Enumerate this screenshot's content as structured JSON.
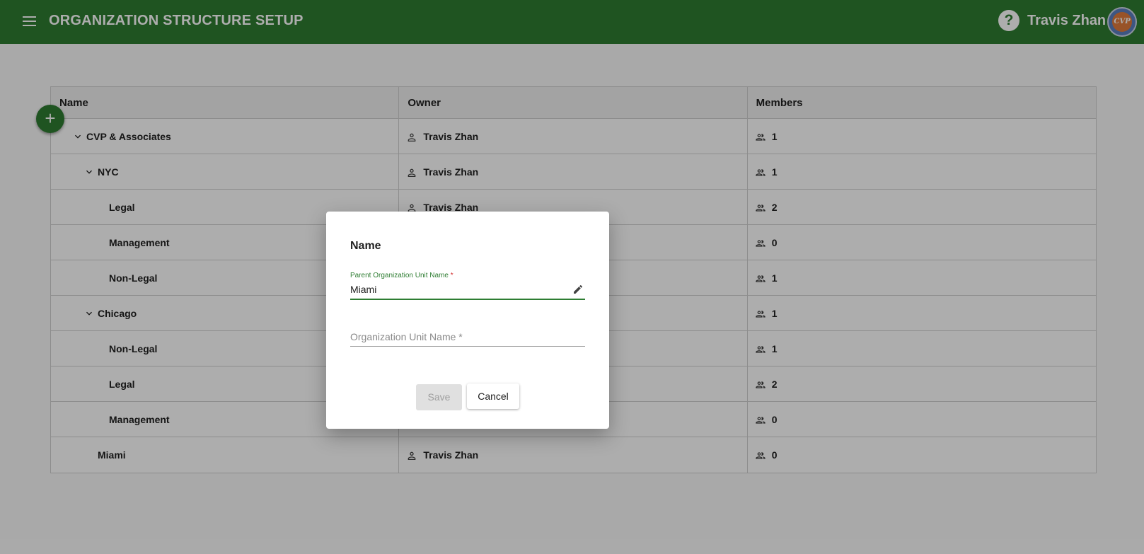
{
  "header": {
    "title": "ORGANIZATION STRUCTURE SETUP",
    "user_name": "Travis Zhan",
    "avatar_text": "CVP",
    "help_icon": "help-circle-icon",
    "menu_icon": "hamburger-menu-icon"
  },
  "table": {
    "columns": [
      "Name",
      "Owner",
      "Members"
    ],
    "rows": [
      {
        "name": "CVP & Associates",
        "owner": "Travis Zhan",
        "members": "1"
      },
      {
        "name": "NYC",
        "owner": "Travis Zhan",
        "members": "1"
      },
      {
        "name": "Legal",
        "owner": "Travis Zhan",
        "members": "2"
      },
      {
        "name": "Management",
        "owner": "",
        "members": "0"
      },
      {
        "name": "Non-Legal",
        "owner": "",
        "members": "1"
      },
      {
        "name": "Chicago",
        "owner": "",
        "members": "1"
      },
      {
        "name": "Non-Legal",
        "owner": "",
        "members": "1"
      },
      {
        "name": "Legal",
        "owner": "",
        "members": "2"
      },
      {
        "name": "Management",
        "owner": "",
        "members": "0"
      },
      {
        "name": "Miami",
        "owner": "Travis Zhan",
        "members": "0"
      }
    ]
  },
  "dialog": {
    "title": "Name",
    "parent_field_label": "Parent Organization Unit Name",
    "parent_field_required": "*",
    "parent_field_value": "Miami",
    "unit_field_placeholder": "Organization Unit Name *",
    "save_label": "Save",
    "cancel_label": "Cancel"
  },
  "colors": {
    "brand_green": "#2e7d32",
    "required_red": "#d32f2f"
  }
}
